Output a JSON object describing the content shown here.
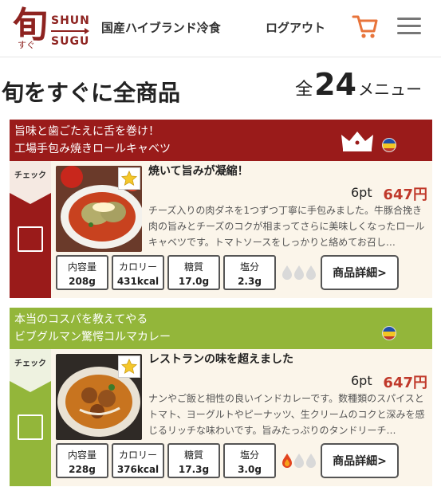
{
  "header": {
    "logo": {
      "kanji": "旬",
      "kana": "すぐ",
      "line1": "SHUN",
      "line2": "SUGU"
    },
    "nav_brand": "国産ハイブランド冷食",
    "nav_logout": "ログアウト",
    "accent": "#e8743b",
    "brand_color": "#8e2320"
  },
  "page": {
    "title": "旬をすぐに全商品",
    "count_prefix": "全",
    "count": "24",
    "count_suffix": "メニュー"
  },
  "products": [
    {
      "header_line1": "旨味と歯ごたえに舌を巻け！",
      "header_line2": "工場手包み焼きロールキャベツ",
      "check_label": "チェック",
      "headline": "焼いて旨みが凝縮！",
      "points": "6pt",
      "price": "647円",
      "description": "チーズ入りの肉ダネを1つずつ丁寧に手包みました。牛豚合挽き肉の旨みとチーズのコクが相まってさらに美味しくなったロールキャベツです。トマトソースをしっかりと絡めてお召し…",
      "stats": [
        {
          "label": "内容量",
          "value": "208g"
        },
        {
          "label": "カロリー",
          "value": "431kcal"
        },
        {
          "label": "糖質",
          "value": "17.0g"
        },
        {
          "label": "塩分",
          "value": "2.3g"
        }
      ],
      "spice_level": 0,
      "detail_label": "商品詳細>",
      "color": "#9a1b1a"
    },
    {
      "header_line1": "本当のコスパを教えてやる",
      "header_line2": "ビブグルマン驚愕コルマカレー",
      "check_label": "チェック",
      "headline": "レストランの味を超えました",
      "points": "6pt",
      "price": "647円",
      "description": "ナンやご飯と相性の良いインドカレーです。数種類のスパイスとトマト、ヨーグルトやピーナッツ、生クリームのコクと深みを感じるリッチな味わいです。旨みたっぷりのタンドリーチ…",
      "stats": [
        {
          "label": "内容量",
          "value": "228g"
        },
        {
          "label": "カロリー",
          "value": "376kcal"
        },
        {
          "label": "糖質",
          "value": "17.3g"
        },
        {
          "label": "塩分",
          "value": "3.0g"
        }
      ],
      "spice_level": 1,
      "detail_label": "商品詳細>",
      "color": "#93b63a"
    }
  ]
}
